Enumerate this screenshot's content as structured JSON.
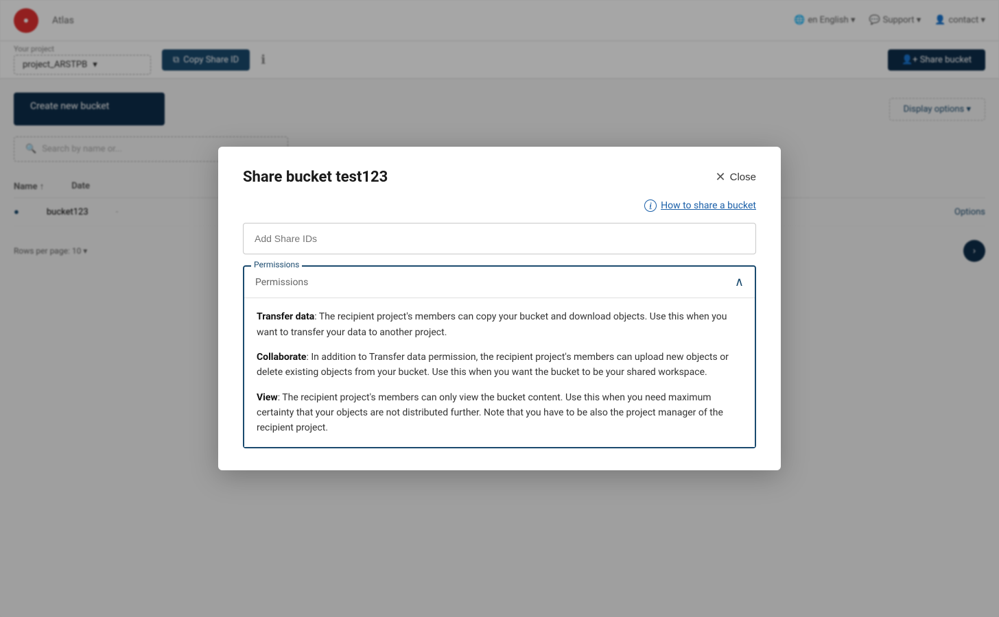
{
  "background": {
    "header": {
      "app_name": "Atlas",
      "nav_items": [
        {
          "label": "en English",
          "icon": "globe-icon"
        },
        {
          "label": "Support",
          "icon": "support-icon"
        },
        {
          "label": "contact",
          "icon": "user-icon"
        }
      ]
    },
    "subheader": {
      "project_label": "Your project",
      "project_value": "project_ARSTPB",
      "copy_button": "Copy Share ID",
      "share_button": "Share bucket"
    },
    "toolbar": {
      "action_button": "Create new bucket",
      "search_placeholder": "Search by name or...",
      "display_options": "Display options"
    },
    "table": {
      "columns": [
        "Name",
        "Date"
      ],
      "rows": [
        {
          "name": "bucket123",
          "date": ""
        }
      ]
    }
  },
  "modal": {
    "title": "Share bucket test123",
    "close_label": "Close",
    "help_link_label": "How to share a bucket",
    "share_ids_placeholder": "Add Share IDs",
    "permissions_label": "Permissions",
    "permissions_placeholder": "Permissions",
    "permission_items": [
      {
        "name": "Transfer data",
        "separator": ": ",
        "description": "The recipient project's members can copy your bucket and download objects. Use this when you want to transfer your data to another project."
      },
      {
        "name": "Collaborate",
        "separator": ": ",
        "description": "In addition to Transfer data permission, the recipient project's members can upload new objects or delete existing objects from your bucket. Use this when you want the bucket to be your shared workspace."
      },
      {
        "name": "View",
        "separator": ": ",
        "description": "The recipient project's members can only view the bucket content. Use this when you need maximum certainty that your objects are not distributed further. Note that you have to be also the project manager of the recipient project."
      }
    ]
  }
}
